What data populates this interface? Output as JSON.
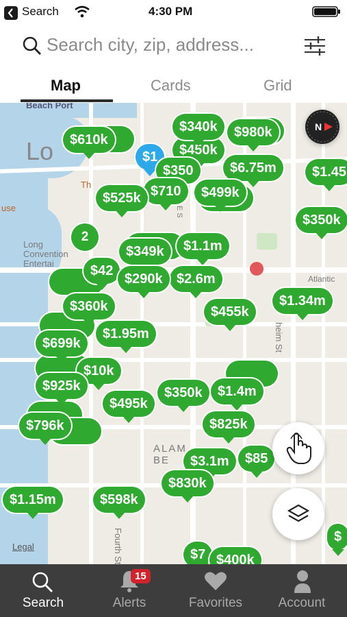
{
  "status_bar": {
    "back_label": "Search",
    "time": "4:30 PM"
  },
  "search": {
    "placeholder": "Search city, zip, address..."
  },
  "tabs": [
    {
      "label": "Map"
    },
    {
      "label": "Cards"
    },
    {
      "label": "Grid"
    }
  ],
  "map": {
    "labels": {
      "beach_port": "Beach Port",
      "lo": "Lo",
      "th": "Th",
      "use": "use",
      "long_convention": "Long Convention Entertai",
      "atlantic": "Atlantic",
      "alamo": "ALAM BE",
      "fourth_st": "Fourth St",
      "heim_st": "heim St",
      "legal": "Legal",
      "e_st": "E S"
    },
    "cluster_count": "2",
    "pins": [
      {
        "price": "$610k"
      },
      {
        "price": "$340k"
      },
      {
        "price": "$980k"
      },
      {
        "price": "$450k"
      },
      {
        "price": "$1"
      },
      {
        "price": "$350"
      },
      {
        "price": "$6.75m"
      },
      {
        "price": "$1.45"
      },
      {
        "price": "$525k"
      },
      {
        "price": "$499k"
      },
      {
        "price": "$710"
      },
      {
        "price": "$350k"
      },
      {
        "price": "$349k"
      },
      {
        "price": "$1.1m"
      },
      {
        "price": "$42"
      },
      {
        "price": "$290k"
      },
      {
        "price": "$2.6m"
      },
      {
        "price": "$1.34m"
      },
      {
        "price": "$360k"
      },
      {
        "price": "$455k"
      },
      {
        "price": "$1.95m"
      },
      {
        "price": "$699k"
      },
      {
        "price": "$10k"
      },
      {
        "price": "$925k"
      },
      {
        "price": "$495k"
      },
      {
        "price": "$350k"
      },
      {
        "price": "$1.4m"
      },
      {
        "price": "$796k"
      },
      {
        "price": "$825k"
      },
      {
        "price": "$3.1m"
      },
      {
        "price": "$85"
      },
      {
        "price": "$830k"
      },
      {
        "price": "$1.15m"
      },
      {
        "price": "$598k"
      },
      {
        "price": "$7"
      },
      {
        "price": "$400k"
      },
      {
        "price": "$"
      }
    ]
  },
  "bottom_nav": [
    {
      "label": "Search"
    },
    {
      "label": "Alerts"
    },
    {
      "label": "Favorites"
    },
    {
      "label": "Account"
    }
  ],
  "alerts_badge": "15",
  "colors": {
    "pin_green": "#2fa92f",
    "pin_blue": "#2da8e8",
    "nav_bg": "#3d3d3d",
    "badge_red": "#d0232d"
  }
}
